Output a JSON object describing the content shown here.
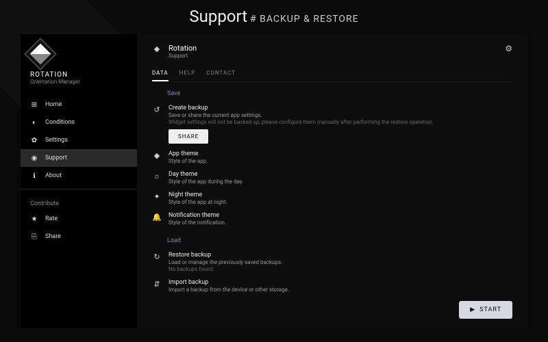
{
  "page_header": {
    "title": "Support",
    "subtitle": "# BACKUP & RESTORE"
  },
  "brand": {
    "title": "ROTATION",
    "subtitle": "Orientation Manager"
  },
  "nav": {
    "items": [
      {
        "label": "Home",
        "icon": "⊞"
      },
      {
        "label": "Conditions",
        "icon": "◐"
      },
      {
        "label": "Settings",
        "icon": "✿"
      },
      {
        "label": "Support",
        "icon": "◉",
        "active": true
      },
      {
        "label": "About",
        "icon": "ℹ"
      }
    ],
    "contribute_label": "Contribute",
    "contribute": [
      {
        "label": "Rate",
        "icon": "★"
      },
      {
        "label": "Share",
        "icon": "⎘"
      }
    ]
  },
  "main": {
    "icon": "◆",
    "title": "Rotation",
    "subtitle": "Support",
    "settings_icon": "⚙"
  },
  "tabs": [
    {
      "label": "DATA",
      "active": true
    },
    {
      "label": "HELP"
    },
    {
      "label": "CONTACT"
    }
  ],
  "sections": {
    "save": {
      "label": "Save",
      "create": {
        "title": "Create backup",
        "desc": "Save or share the current app settings.",
        "note": "Widget settings will not be backed up, please configure them manually after performing the restore operation.",
        "share_btn": "SHARE"
      },
      "items": [
        {
          "icon": "◆",
          "title": "App theme",
          "desc": "Style of the app."
        },
        {
          "icon": "☼",
          "title": "Day theme",
          "desc": "Style of the app during the day."
        },
        {
          "icon": "✦",
          "title": "Night theme",
          "desc": "Style of the app at night."
        },
        {
          "icon": "🔔",
          "title": "Notification theme",
          "desc": "Style of the notification."
        }
      ]
    },
    "load": {
      "label": "Load",
      "items": [
        {
          "icon": "↻",
          "title": "Restore backup",
          "desc": "Load or manage the previously saved backups.",
          "note": "No backups found."
        },
        {
          "icon": "⇵",
          "title": "Import backup",
          "desc": "Import a backup from the device or other storage."
        }
      ]
    }
  },
  "start_btn": "START"
}
